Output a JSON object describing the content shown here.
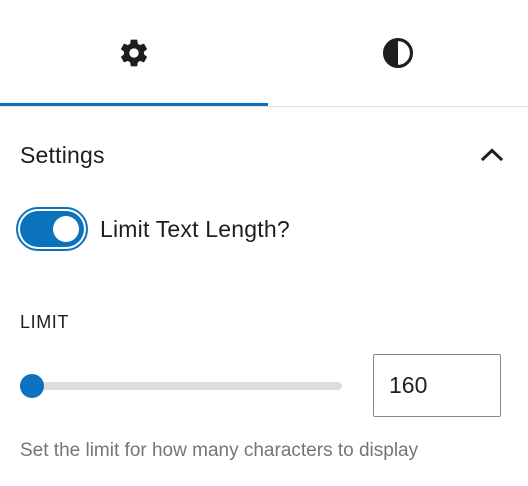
{
  "tabs": [
    {
      "name": "settings",
      "icon": "gear-icon",
      "active": true
    },
    {
      "name": "styles",
      "icon": "contrast-icon",
      "active": false
    }
  ],
  "colors": {
    "accent": "#0a73bc",
    "text": "#1e1e1e",
    "help": "#757575",
    "border": "#e0e0e0"
  },
  "panel": {
    "title": "Settings",
    "expanded": true,
    "toggle": {
      "label": "Limit Text Length?",
      "checked": true
    },
    "limit": {
      "label": "LIMIT",
      "value": "160",
      "slider_fraction": 0.0,
      "help": "Set the limit for how many characters to display"
    }
  }
}
